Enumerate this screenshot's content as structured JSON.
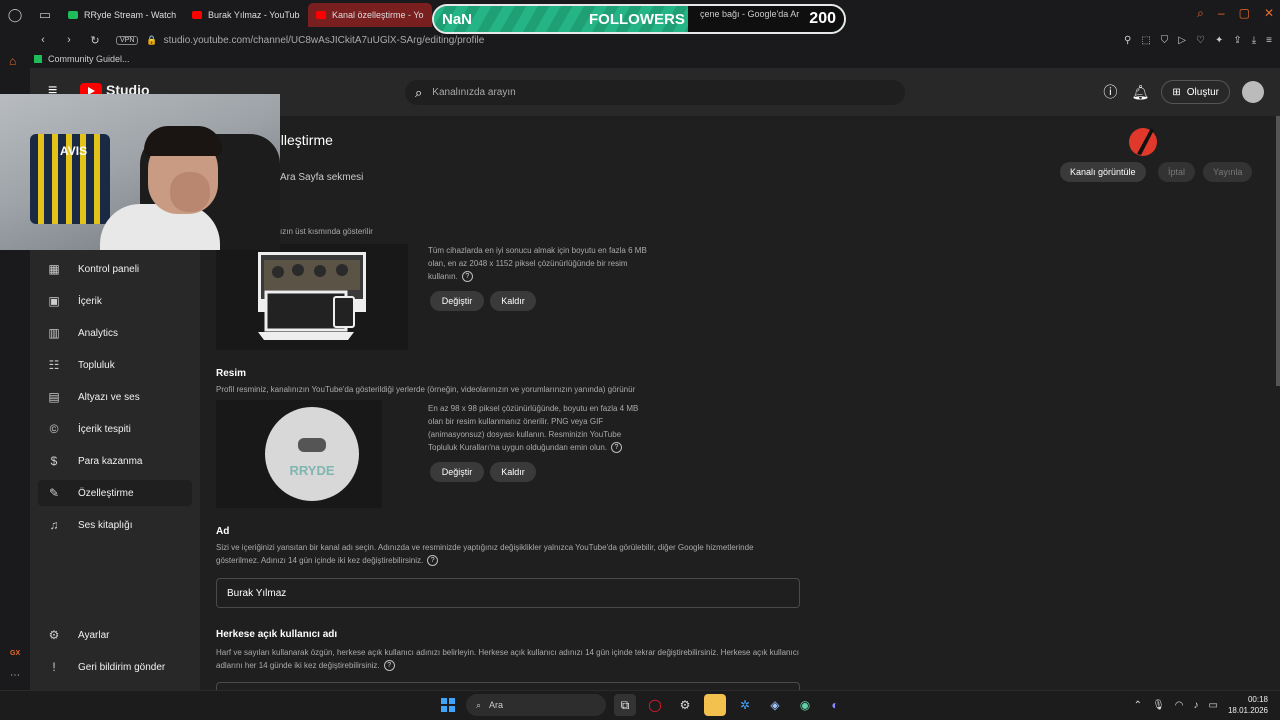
{
  "browser": {
    "tabs": [
      {
        "label": "RRyde Stream - Watch Liv",
        "fav": "rr",
        "active": false
      },
      {
        "label": "Burak Yılmaz - YouTube",
        "fav": "yt",
        "active": false
      },
      {
        "label": "Kanal özelleştirme - YouT",
        "fav": "yt",
        "active": true
      }
    ],
    "behind_tab_label": "çene bağı - Google'da Ar",
    "url": "studio.youtube.com/channel/UC8wAsJICkitA7uUGlX-SArg/editing/profile",
    "vpn_label": "VPN",
    "bookmark": "Community Guidel..."
  },
  "overlay": {
    "left": "NaN",
    "label": "FOLLOWERS",
    "count": "200",
    "accent": "#1aa67a"
  },
  "header": {
    "logo_text": "Studio",
    "search_placeholder": "Kanalınızda arayın",
    "create_label": "Oluştur"
  },
  "sidebar": {
    "items": [
      {
        "label": "Kontrol paneli",
        "icon": "dashboard-icon"
      },
      {
        "label": "İçerik",
        "icon": "content-icon"
      },
      {
        "label": "Analytics",
        "icon": "analytics-icon"
      },
      {
        "label": "Topluluk",
        "icon": "community-icon"
      },
      {
        "label": "Altyazı ve ses",
        "icon": "subtitles-icon"
      },
      {
        "label": "İçerik tespiti",
        "icon": "copyright-icon"
      },
      {
        "label": "Para kazanma",
        "icon": "monetization-icon"
      },
      {
        "label": "Özelleştirme",
        "icon": "customization-icon"
      },
      {
        "label": "Ses kitaplığı",
        "icon": "audio-library-icon"
      }
    ],
    "settings": "Ayarlar",
    "feedback": "Geri bildirim gönder"
  },
  "main": {
    "title": "zelleştirme",
    "sub_tab": "Ara Sayfa sekmesi",
    "view_channel": "Kanalı görüntüle",
    "cancel": "İptal",
    "publish": "Yayınla",
    "banner": {
      "hint": "ızın üst kısmında gösterilir",
      "info": "Tüm cihazlarda en iyi sonucu almak için boyutu en fazla 6 MB olan, en az 2048 x 1152 piksel çözünürlüğünde bir resim kullanın.",
      "change": "Değiştir",
      "remove": "Kaldır"
    },
    "picture": {
      "title": "Resim",
      "desc": "Profil resminiz, kanalınızın YouTube'da gösterildiği yerlerde (örneğin, videolarınızın ve yorumlarınızın yanında) görünür",
      "info": "En az 98 x 98 piksel çözünürlüğünde, boyutu en fazla 4 MB olan bir resim kullanmanız önerilir. PNG veya GIF (animasyonsuz) dosyası kullanın. Resminizin YouTube Topluluk Kuralları'na uygun olduğundan emin olun.",
      "avatar_text": "RRYDE",
      "change": "Değiştir",
      "remove": "Kaldır"
    },
    "name": {
      "title": "Ad",
      "desc": "Sizi ve içeriğinizi yansıtan bir kanal adı seçin. Adınızda ve resminizde yaptığınız değişiklikler yalnızca YouTube'da görülebilir, diğer Google hizmetlerinde gösterilmez. Adınızı 14 gün içinde iki kez değiştirebilirsiniz.",
      "value": "Burak Yılmaz"
    },
    "handle": {
      "title": "Herkese açık kullanıcı adı",
      "desc": "Harf ve sayıları kullanarak özgün, herkese açık kullanıcı adınızı belirleyin. Herkese açık kullanıcı adınızı 14 gün içinde tekrar değiştirebilirsiniz. Herkese açık kullanıcı adlarını her 14 günde iki kez değiştirebilirsiniz."
    }
  },
  "webcam": {
    "shirt_text": "AVIS"
  },
  "taskbar": {
    "search_label": "Ara",
    "time": "00:18",
    "date": "18.01.2026"
  },
  "opera": {
    "gx": "GX"
  }
}
